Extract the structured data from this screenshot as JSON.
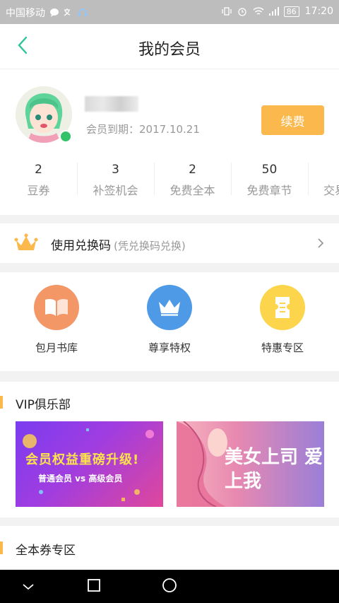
{
  "status_bar": {
    "carrier": "中国移动",
    "battery": "86",
    "time": "17:20"
  },
  "header": {
    "title": "我的会员"
  },
  "member": {
    "expire_text": "会员到期：2017.10.21",
    "renew_label": "续费"
  },
  "stats": [
    {
      "value": "2",
      "label": "豆券"
    },
    {
      "value": "3",
      "label": "补签机会"
    },
    {
      "value": "2",
      "label": "免费全本"
    },
    {
      "value": "50",
      "label": "免费章节"
    },
    {
      "value": "",
      "label": "交易"
    }
  ],
  "redeem": {
    "title": "使用兑换码",
    "subtitle": "(凭兑换码兑换)"
  },
  "features": [
    {
      "label": "包月书库",
      "color": "#f49766"
    },
    {
      "label": "尊享特权",
      "color": "#4f9ae6"
    },
    {
      "label": "特惠专区",
      "color": "#fdd54c"
    }
  ],
  "vip_club": {
    "title": "VIP俱乐部",
    "banners": [
      {
        "title": "会员权益重磅升级!",
        "subtitle": "普通会员 vs 高级会员"
      },
      {
        "title": "美女上司 爱上我"
      }
    ]
  },
  "coupon_section": {
    "title": "全本券专区"
  },
  "colors": {
    "accent": "#fbb84c",
    "back_arrow": "#2cc39a"
  }
}
